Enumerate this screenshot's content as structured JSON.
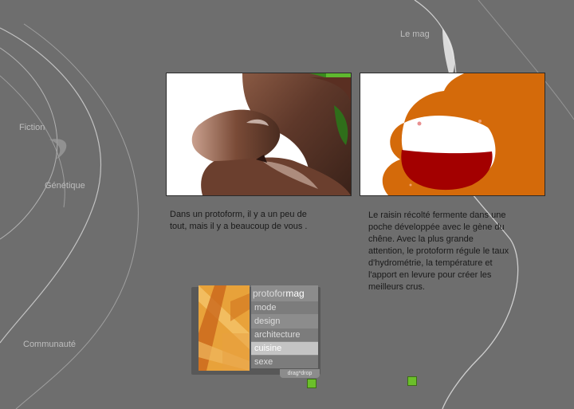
{
  "nav": {
    "le_mag": "Le mag",
    "fiction": "Fiction",
    "genetique": "Génétique",
    "communaute": "Communauté"
  },
  "captions": {
    "left": [
      "Dans un protoform, il y a un peu de",
      "tout, mais il y a  beaucoup de vous ."
    ],
    "right": [
      "Le raisin récolté fermente dans une",
      "poche développée avec le gène du",
      "chêne.  Avec la plus grande",
      "attention, le protoform régule le taux",
      "d'hydrométrie, la température et",
      "l'apport en levure pour créer les",
      "meilleurs crus."
    ]
  },
  "widget": {
    "title_part1": "protofor",
    "title_part2": "mag",
    "items": [
      "mode",
      "design",
      "architecture",
      "cuisine",
      "sexe"
    ],
    "selected": "cuisine",
    "drag_label": "drag*drop"
  },
  "colors": {
    "background": "#6e6e6e",
    "accent_orange": "#d46a0a",
    "wine_red": "#a30000",
    "green_square": "#6bbf2a"
  }
}
